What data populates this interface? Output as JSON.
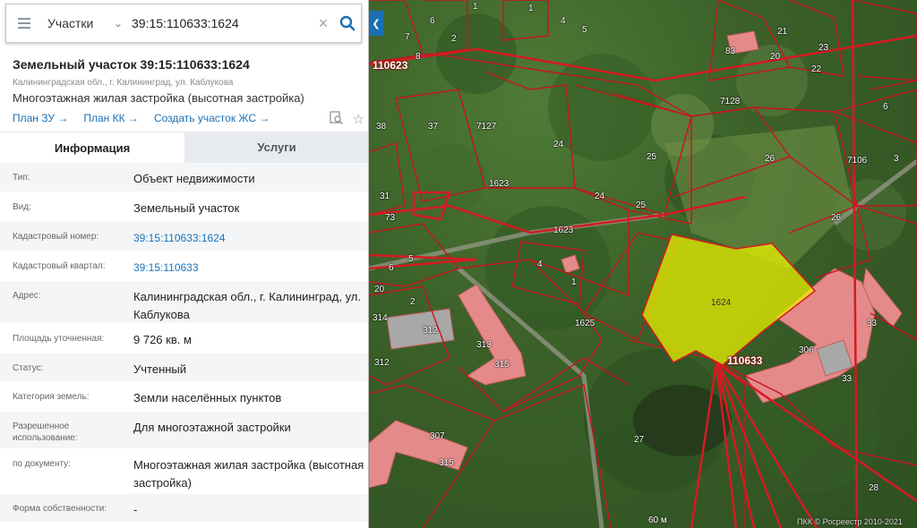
{
  "search": {
    "category": "Участки",
    "value": "39:15:110633:1624"
  },
  "header": {
    "title": "Земельный участок 39:15:110633:1624",
    "address": "Калининградская обл., г. Калининград, ул. Каблукова",
    "purpose": "Многоэтажная жилая застройка (высотная застройка)",
    "links": [
      "План ЗУ →",
      "План КК →",
      "Создать участок ЖС →"
    ]
  },
  "tabs": {
    "info": "Информация",
    "services": "Услуги"
  },
  "details": [
    {
      "label": "Тип:",
      "value": "Объект недвижимости"
    },
    {
      "label": "Вид:",
      "value": "Земельный участок"
    },
    {
      "label": "Кадастровый номер:",
      "value": "39:15:110633:1624"
    },
    {
      "label": "Кадастровый квартал:",
      "value": "39:15:110633"
    },
    {
      "label": "Адрес:",
      "value": "Калининградская обл., г. Калининград, ул. Каблукова"
    },
    {
      "label": "Площадь уточненная:",
      "value": "9 726 кв. м"
    },
    {
      "label": "Статус:",
      "value": "Учтенный"
    },
    {
      "label": "Категория земель:",
      "value": "Земли населённых пунктов"
    },
    {
      "label": "Разрешенное использование:",
      "value": "Для многоэтажной застройки"
    },
    {
      "label": "по документу:",
      "value": "Многоэтажная жилая застройка (высотная застройка)"
    },
    {
      "label": "Форма собственности:",
      "value": "-"
    }
  ],
  "map": {
    "parcel_labels": [
      "6",
      "2",
      "5",
      "4",
      "8",
      "1",
      "7",
      "1",
      "83",
      "21",
      "20",
      "22",
      "23",
      "7128",
      "6",
      "38",
      "37",
      "7127",
      "24",
      "25",
      "26",
      "7106",
      "3",
      "1623",
      "24",
      "25",
      "31",
      "73",
      "26",
      "1623",
      "5",
      "6",
      "4",
      "1",
      "20",
      "2",
      "314",
      "1625",
      "312",
      "313",
      "312",
      "315",
      "307",
      "315",
      "27",
      "1624",
      "306",
      "33",
      "33",
      "28"
    ],
    "quarter_labels": [
      "110623",
      "110633"
    ],
    "scale": "60 м",
    "copyright": "ПКК © Росреестр 2010-2021"
  },
  "colors": {
    "accent": "#1a72b8",
    "parcel_border": "#c8141e",
    "selected_fill": "#e8f000",
    "building": "#e58a8a"
  }
}
